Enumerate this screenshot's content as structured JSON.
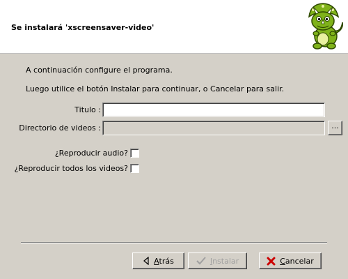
{
  "header": {
    "title": "Se instalará 'xscreensaver-video'"
  },
  "intro": {
    "line1": "A continuación configure el programa.",
    "line2": "Luego utilice el botón Instalar para continuar, o Cancelar para salir."
  },
  "form": {
    "titulo_label": "Titulo :",
    "titulo_value": "",
    "directorio_label": "Directorio de videos :",
    "directorio_value": "",
    "browse_label": "...",
    "audio_label": "¿Reproducir audio?",
    "audio_checked": false,
    "all_videos_label": "¿Reproducir todos los videos?",
    "all_videos_checked": false
  },
  "buttons": {
    "back": {
      "label_u": "A",
      "label_rest": "trás",
      "enabled": true
    },
    "install": {
      "label_u": "I",
      "label_rest": "nstalar",
      "enabled": false
    },
    "cancel": {
      "label_u": "C",
      "label_rest": "ancelar",
      "enabled": true
    }
  },
  "icons": {
    "logo": "dinosaur-mascot-icon",
    "back": "arrow-left-icon",
    "install": "checkmark-icon",
    "cancel": "red-x-icon"
  },
  "colors": {
    "background": "#d4d0c8",
    "header_background": "#ffffff",
    "logo_green": "#7fb21a",
    "cancel_red": "#cc0000"
  }
}
